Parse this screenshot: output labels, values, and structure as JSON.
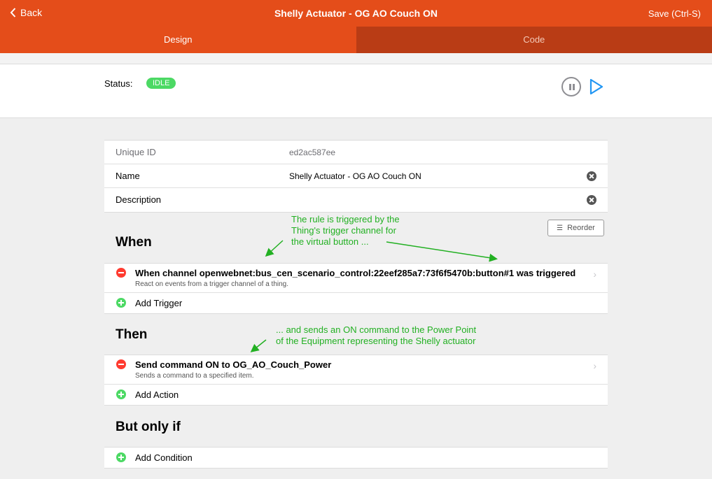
{
  "header": {
    "back_label": "Back",
    "title": "Shelly Actuator - OG AO Couch ON",
    "save_label": "Save (Ctrl-S)"
  },
  "tabs": [
    {
      "label": "Design",
      "active": true
    },
    {
      "label": "Code",
      "active": false
    }
  ],
  "status": {
    "label": "Status:",
    "value": "IDLE",
    "color": "#4cd964"
  },
  "info": {
    "uid_label": "Unique ID",
    "uid_value": "ed2ac587ee",
    "name_label": "Name",
    "name_value": "Shelly Actuator - OG AO Couch ON",
    "description_label": "Description",
    "description_value": ""
  },
  "reorder_label": "Reorder",
  "when": {
    "title": "When",
    "items": [
      {
        "title": "When channel openwebnet:bus_cen_scenario_control:22eef285a7:73f6f5470b:button#1 was triggered",
        "subtitle": "React on events from a trigger channel of a thing."
      }
    ],
    "add_label": "Add Trigger"
  },
  "then": {
    "title": "Then",
    "items": [
      {
        "title": "Send command ON to OG_AO_Couch_Power",
        "subtitle": "Sends a command to a specified item."
      }
    ],
    "add_label": "Add Action"
  },
  "but_only_if": {
    "title": "But only if",
    "add_label": "Add Condition"
  },
  "annotations": {
    "note1_line1": "The rule is triggered by the",
    "note1_line2": "Thing's trigger channel for",
    "note1_line3": "the virtual button ...",
    "note2_line1": "... and sends an ON command to the Power Point",
    "note2_line2": "of the Equipment representing the Shelly actuator"
  },
  "colors": {
    "brand": "#e44d1a",
    "tab_inactive": "#b93c15",
    "annotation": "#22b022",
    "remove": "#ff3b30",
    "add": "#4cd964"
  }
}
